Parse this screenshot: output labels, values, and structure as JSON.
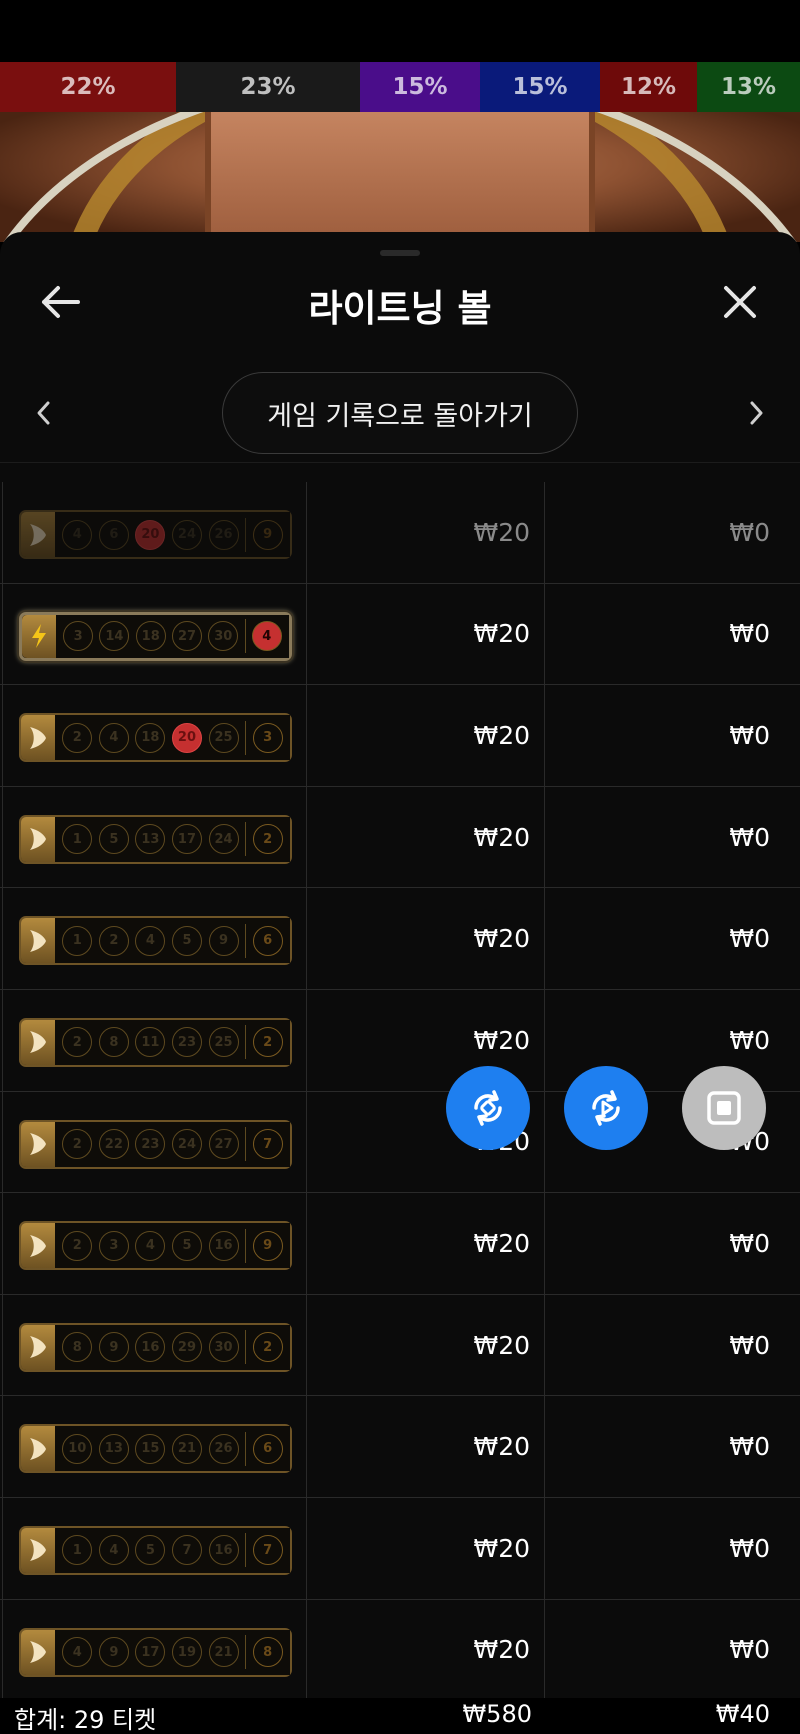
{
  "stats": [
    {
      "label": "22%",
      "color": "#7a0f0f",
      "share": 22
    },
    {
      "label": "23%",
      "color": "#1a1a1a",
      "share": 23
    },
    {
      "label": "15%",
      "color": "#4a0d8a",
      "share": 15
    },
    {
      "label": "15%",
      "color": "#0a1a7a",
      "share": 15
    },
    {
      "label": "12%",
      "color": "#6e0a0a",
      "share": 12
    },
    {
      "label": "13%",
      "color": "#0c4a12",
      "share": 13
    }
  ],
  "header": {
    "title": "라이트닝 볼"
  },
  "nav": {
    "back_history_label": "게임 기록으로 돌아가기"
  },
  "rows": [
    {
      "type": "normal",
      "balls": [
        "4",
        "6",
        "20",
        "24",
        "26"
      ],
      "hits": [
        2
      ],
      "bonus": "9",
      "bonus_hit": false,
      "bet": "₩20",
      "win": "₩0",
      "faded": true
    },
    {
      "type": "lightning",
      "balls": [
        "3",
        "14",
        "18",
        "27",
        "30"
      ],
      "hits": [],
      "bonus": "4",
      "bonus_hit": true,
      "bet": "₩20",
      "win": "₩0",
      "faded": false
    },
    {
      "type": "normal",
      "balls": [
        "2",
        "4",
        "18",
        "20",
        "25"
      ],
      "hits": [
        3
      ],
      "bonus": "3",
      "bonus_hit": false,
      "bet": "₩20",
      "win": "₩0",
      "faded": false
    },
    {
      "type": "normal",
      "balls": [
        "1",
        "5",
        "13",
        "17",
        "24"
      ],
      "hits": [],
      "bonus": "2",
      "bonus_hit": false,
      "bet": "₩20",
      "win": "₩0",
      "faded": false
    },
    {
      "type": "normal",
      "balls": [
        "1",
        "2",
        "4",
        "5",
        "9"
      ],
      "hits": [],
      "bonus": "6",
      "bonus_hit": false,
      "bet": "₩20",
      "win": "₩0",
      "faded": false
    },
    {
      "type": "normal",
      "balls": [
        "2",
        "8",
        "11",
        "23",
        "25"
      ],
      "hits": [],
      "bonus": "2",
      "bonus_hit": false,
      "bet": "₩20",
      "win": "₩0",
      "faded": false
    },
    {
      "type": "normal",
      "balls": [
        "2",
        "22",
        "23",
        "24",
        "27"
      ],
      "hits": [],
      "bonus": "7",
      "bonus_hit": false,
      "bet": "₩20",
      "win": "₩0",
      "faded": false
    },
    {
      "type": "normal",
      "balls": [
        "2",
        "3",
        "4",
        "5",
        "16"
      ],
      "hits": [],
      "bonus": "9",
      "bonus_hit": false,
      "bet": "₩20",
      "win": "₩0",
      "faded": false
    },
    {
      "type": "normal",
      "balls": [
        "8",
        "9",
        "16",
        "29",
        "30"
      ],
      "hits": [],
      "bonus": "2",
      "bonus_hit": false,
      "bet": "₩20",
      "win": "₩0",
      "faded": false
    },
    {
      "type": "normal",
      "balls": [
        "10",
        "13",
        "15",
        "21",
        "26"
      ],
      "hits": [],
      "bonus": "6",
      "bonus_hit": false,
      "bet": "₩20",
      "win": "₩0",
      "faded": false
    },
    {
      "type": "normal",
      "balls": [
        "1",
        "4",
        "5",
        "7",
        "16"
      ],
      "hits": [],
      "bonus": "7",
      "bonus_hit": false,
      "bet": "₩20",
      "win": "₩0",
      "faded": false
    },
    {
      "type": "normal",
      "balls": [
        "4",
        "9",
        "17",
        "19",
        "21"
      ],
      "hits": [],
      "bonus": "8",
      "bonus_hit": false,
      "bet": "₩20",
      "win": "₩0",
      "faded": false
    }
  ],
  "fabs": [
    {
      "name": "rotate-sync-icon",
      "color": "#1e7ff0"
    },
    {
      "name": "replay-icon",
      "color": "#1e7ff0"
    },
    {
      "name": "stop-icon",
      "color": "#bdbdbd"
    }
  ],
  "footer": {
    "total_label": "합계: 29 티켓",
    "total_bet": "₩580",
    "total_win": "₩40"
  }
}
